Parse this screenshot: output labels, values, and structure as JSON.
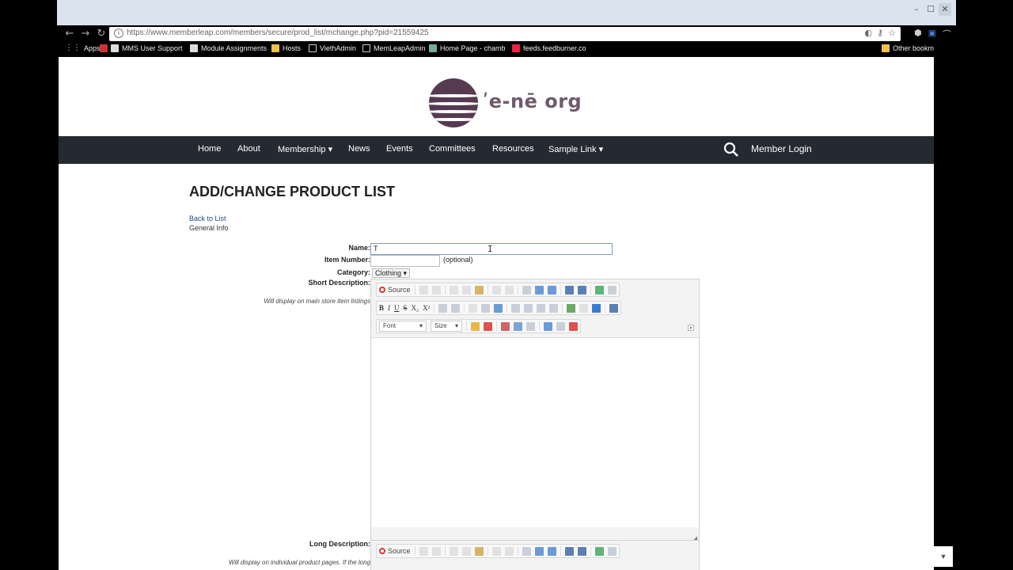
{
  "browser": {
    "url": "https://www.memberleap.com/members/secure/prod_list/mchange.php?pid=21559425",
    "window_controls": {
      "minimize": "–",
      "maximize": "☐",
      "close": "✕"
    },
    "bookmarks": [
      "Apps",
      "MMS User Support",
      "Module Assignments",
      "Hosts",
      "ViethAdmin",
      "MemLeapAdmin",
      "Home Page - chamb",
      "feeds.feedburner.co"
    ],
    "other_bookmarks": "Other bookm"
  },
  "site": {
    "logo_text": "ʹe-nē org",
    "brand_color": "#563a52",
    "nav_bg": "#252a32",
    "nav": [
      "Home",
      "About",
      "Membership ▾",
      "News",
      "Events",
      "Committees",
      "Resources",
      "Sample Link ▾"
    ],
    "member_login": "Member Login"
  },
  "page": {
    "title": "ADD/CHANGE PRODUCT LIST",
    "back_link": "Back to List",
    "section": "General Info"
  },
  "form": {
    "name_label": "Name:",
    "name_value": "T",
    "item_number_label": "Item Number:",
    "item_number_hint": "(optional)",
    "category_label": "Category:",
    "category_value": "Clothing ▾",
    "short_desc_label": "Short Description:",
    "short_desc_hint": "Will display on main store item listings",
    "long_desc_label": "Long Description:",
    "long_desc_hint": "Will display on individual product pages. If the long"
  },
  "editor": {
    "source_label": "Source",
    "font_label": "Font",
    "size_label": "Size",
    "bold": "B",
    "italic": "I",
    "underline": "U",
    "strike": "S",
    "subscript": "X₂",
    "superscript": "X²"
  }
}
